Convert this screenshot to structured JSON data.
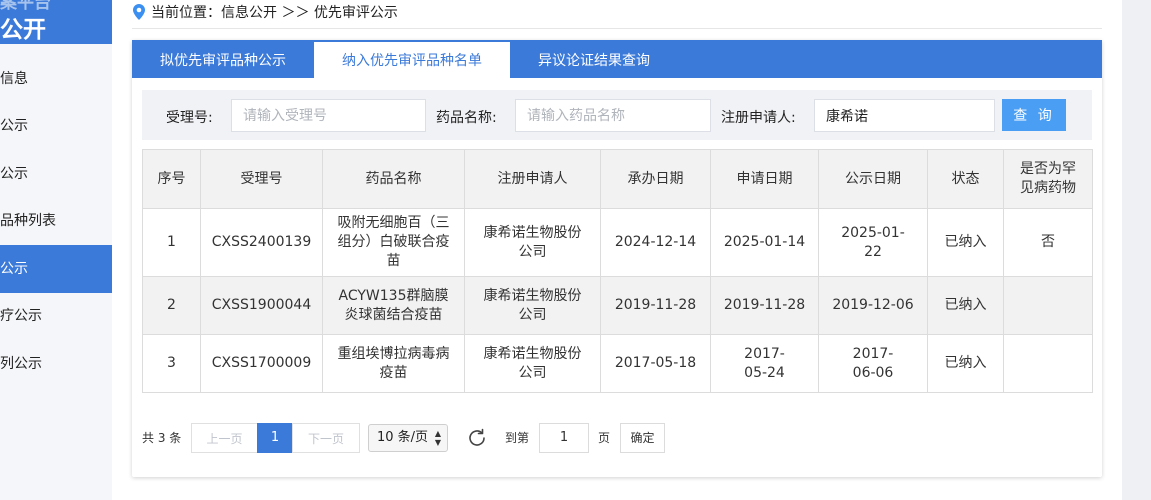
{
  "sidebar": {
    "header_line1": "案平台",
    "header_line2": "公开",
    "items": [
      {
        "label": "信息",
        "active": false
      },
      {
        "label": "公示",
        "active": false
      },
      {
        "label": "公示",
        "active": false
      },
      {
        "label": "品种列表",
        "active": false
      },
      {
        "label": "公示",
        "active": true
      },
      {
        "label": "疗公示",
        "active": false
      },
      {
        "label": "列公示",
        "active": false
      }
    ]
  },
  "breadcrumb": {
    "icon": "location-pin-icon",
    "text": "当前位置：信息公开 ＞＞ 优先审评公示"
  },
  "tabs": [
    {
      "label": "拟优先审评品种公示",
      "active": false
    },
    {
      "label": "纳入优先审评品种名单",
      "active": true
    },
    {
      "label": "异议论证结果查询",
      "active": false
    }
  ],
  "filter": {
    "accept_no_label": "受理号:",
    "accept_no_placeholder": "请输入受理号",
    "drug_name_label": "药品名称:",
    "drug_name_placeholder": "请输入药品名称",
    "applicant_label": "注册申请人:",
    "applicant_value": "康希诺",
    "query_button": "查 询"
  },
  "table": {
    "headers": [
      "序号",
      "受理号",
      "药品名称",
      "注册申请人",
      "承办日期",
      "申请日期",
      "公示日期",
      "状态",
      "是否为罕见病药物"
    ],
    "rows": [
      [
        "1",
        "CXSS2400139",
        "吸附无细胞百（三组分）白破联合疫苗",
        "康希诺生物股份公司",
        "2024-12-14",
        "2025-01-14",
        "2025-01-22",
        "已纳入",
        "否"
      ],
      [
        "2",
        "CXSS1900044",
        "ACYW135群脑膜炎球菌结合疫苗",
        "康希诺生物股份公司",
        "2019-11-28",
        "2019-11-28",
        "2019-12-06",
        "已纳入",
        ""
      ],
      [
        "3",
        "CXSS1700009",
        "重组埃博拉病毒病疫苗",
        "康希诺生物股份公司",
        "2017-05-18",
        "2017-05-24",
        "2017-06-06",
        "已纳入",
        ""
      ]
    ]
  },
  "pagination": {
    "total": "共 3 条",
    "prev": "上一页",
    "current": "1",
    "next": "下一页",
    "page_size": "10 条/页",
    "goto_label": "到第",
    "goto_value": "1",
    "page_unit": "页",
    "confirm": "确定"
  },
  "colors": {
    "accent": "#3b7ad9",
    "query_button": "#4a9ff5"
  }
}
